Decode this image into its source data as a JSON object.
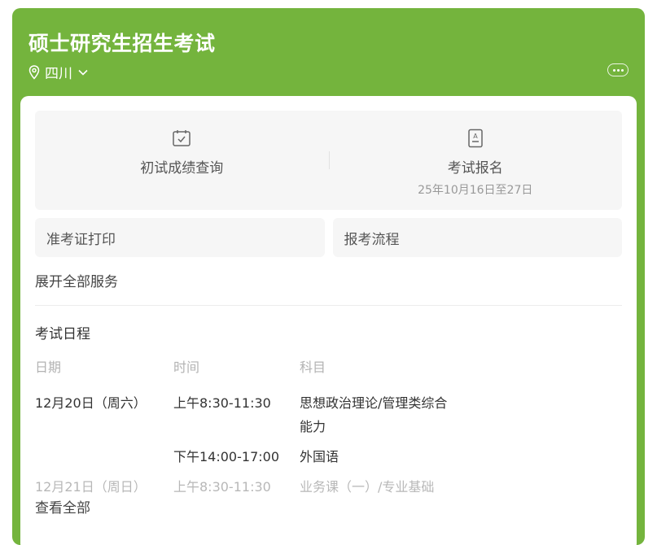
{
  "header": {
    "title": "硕士研究生招生考试",
    "location": "四川",
    "icons": {
      "location": "location-pin-icon",
      "dropdown": "chevron-down-icon",
      "more": "more-dots-icon"
    }
  },
  "services": {
    "primary": [
      {
        "label": "初试成绩查询",
        "icon": "calendar-check-icon"
      },
      {
        "label": "考试报名",
        "sub": "25年10月16日至27日",
        "icon": "document-icon"
      }
    ],
    "secondary": [
      {
        "label": "准考证打印"
      },
      {
        "label": "报考流程"
      }
    ],
    "expand_label": "展开全部服务"
  },
  "schedule": {
    "title": "考试日程",
    "headers": {
      "date": "日期",
      "time": "时间",
      "subject": "科目"
    },
    "rows": [
      {
        "date": "12月20日（周六）",
        "time": "上午8:30-11:30",
        "subject": "思想政治理论/管理类综合能力"
      },
      {
        "date": "",
        "time": "下午14:00-17:00",
        "subject": "外国语"
      },
      {
        "date": "12月21日（周日）",
        "time": "上午8:30-11:30",
        "subject": "业务课（一）/专业基础"
      }
    ],
    "view_all": "查看全部"
  },
  "colors": {
    "header_bg": "#74b43d",
    "card_bg": "#ffffff",
    "tile_bg": "#f6f6f6"
  }
}
